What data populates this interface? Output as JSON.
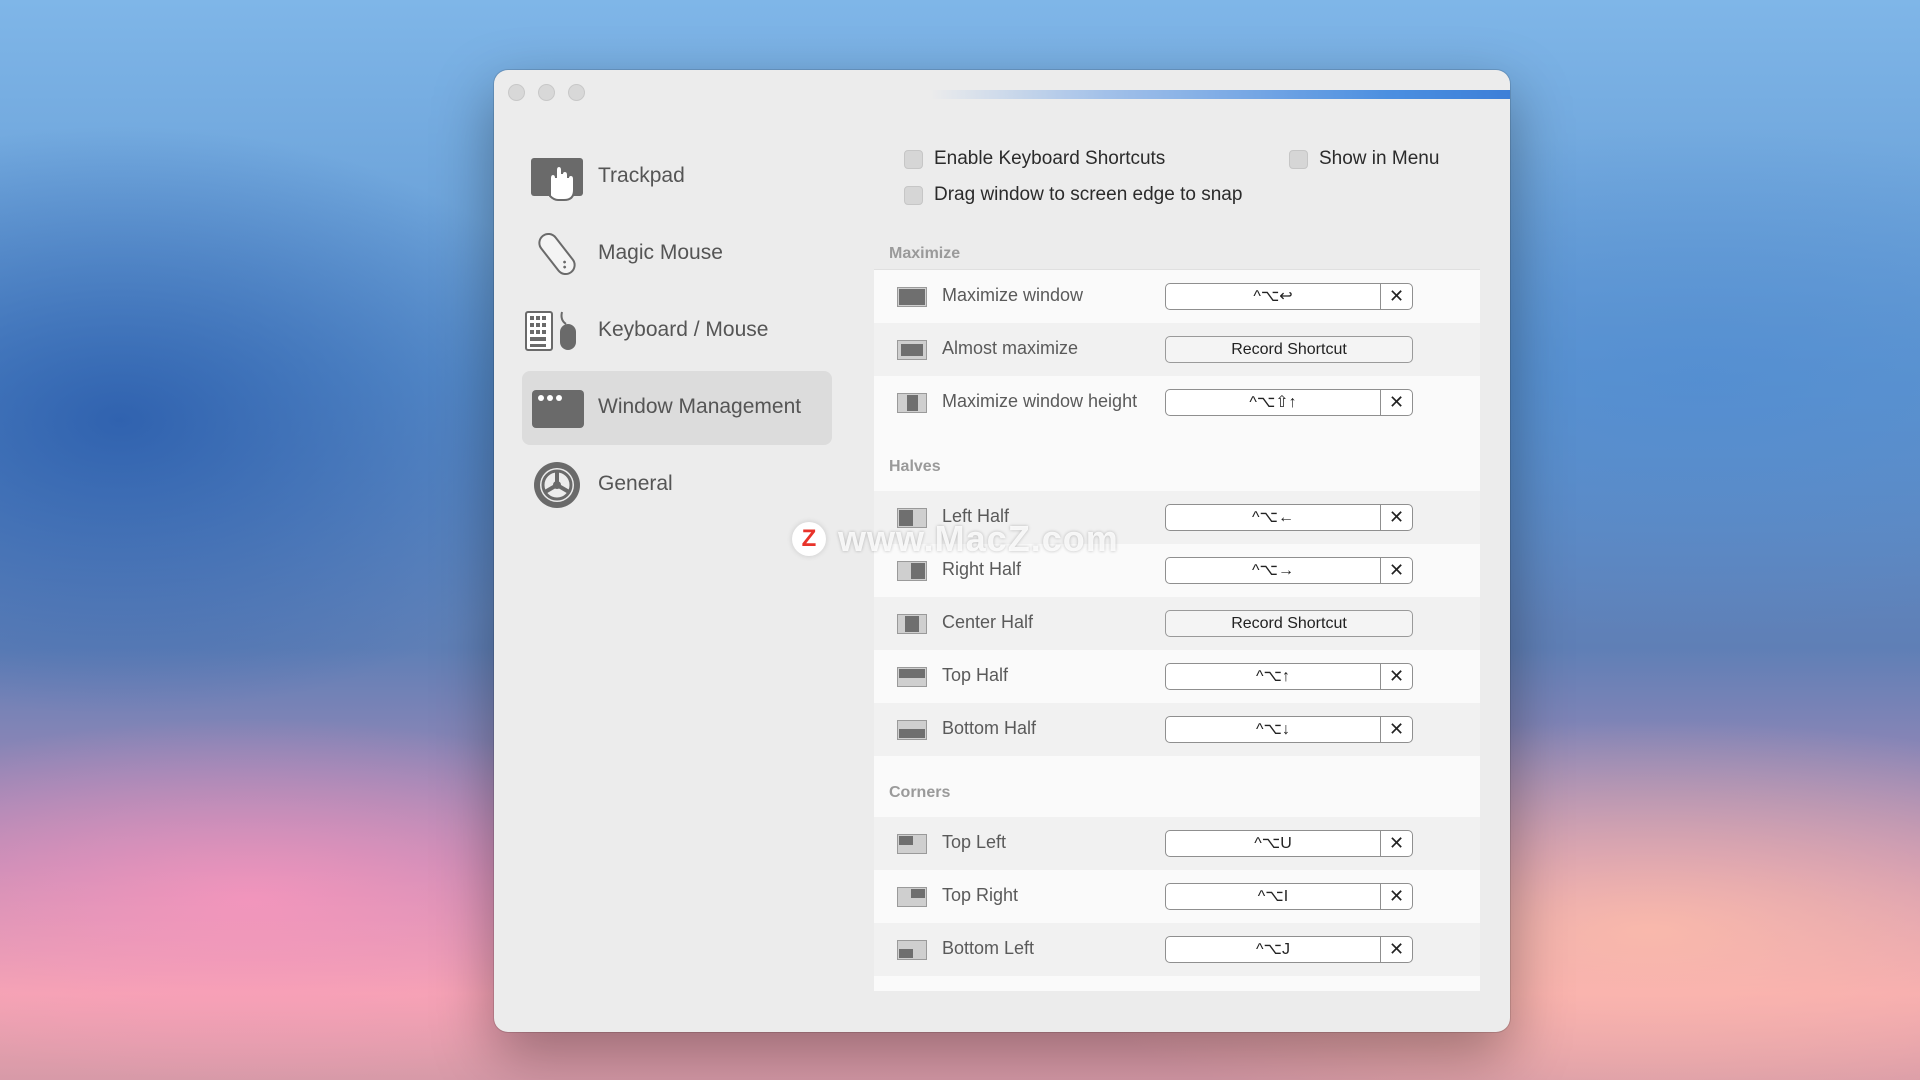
{
  "sidebar": {
    "items": [
      {
        "label": "Trackpad",
        "icon": "trackpad-icon"
      },
      {
        "label": "Magic Mouse",
        "icon": "magic-mouse-icon"
      },
      {
        "label": "Keyboard / Mouse",
        "icon": "keyboard-mouse-icon"
      },
      {
        "label": "Window Management",
        "icon": "window-management-icon",
        "selected": true
      },
      {
        "label": "General",
        "icon": "gear-icon"
      }
    ]
  },
  "options": {
    "enable_shortcuts": "Enable Keyboard Shortcuts",
    "show_in_menu": "Show in Menu",
    "drag_snap": "Drag window to screen edge to snap"
  },
  "sections": {
    "maximize": {
      "title": "Maximize",
      "rows": [
        {
          "label": "Maximize window",
          "shortcut": "^⌥↩",
          "clear": "✕"
        },
        {
          "label": "Almost maximize",
          "shortcut": "Record Shortcut"
        },
        {
          "label": "Maximize window height",
          "shortcut": "^⌥⇧↑",
          "clear": "✕"
        }
      ]
    },
    "halves": {
      "title": "Halves",
      "rows": [
        {
          "label": "Left Half",
          "shortcut": "^⌥←",
          "clear": "✕"
        },
        {
          "label": "Right Half",
          "shortcut": "^⌥→",
          "clear": "✕"
        },
        {
          "label": "Center Half",
          "shortcut": "Record Shortcut"
        },
        {
          "label": "Top Half",
          "shortcut": "^⌥↑",
          "clear": "✕"
        },
        {
          "label": "Bottom Half",
          "shortcut": "^⌥↓",
          "clear": "✕"
        }
      ]
    },
    "corners": {
      "title": "Corners",
      "rows": [
        {
          "label": "Top Left",
          "shortcut": "^⌥U",
          "clear": "✕"
        },
        {
          "label": "Top Right",
          "shortcut": "^⌥I",
          "clear": "✕"
        },
        {
          "label": "Bottom Left",
          "shortcut": "^⌥J",
          "clear": "✕"
        }
      ]
    }
  },
  "watermark": {
    "logo": "Z",
    "text": "www.MacZ.com"
  },
  "colors": {
    "selected_bg": "#dcdcdc",
    "accent_line": "#3d7fd8",
    "window_bg": "#ececec"
  }
}
